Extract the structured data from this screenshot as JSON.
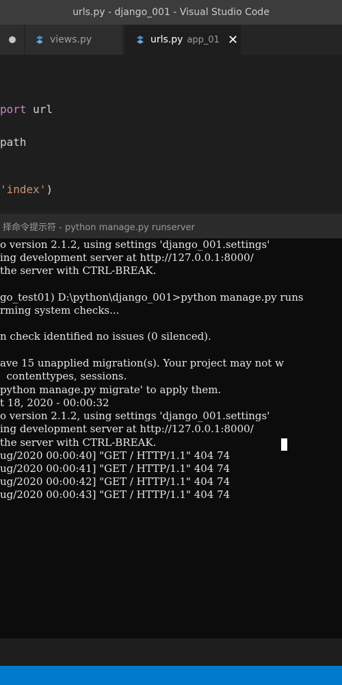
{
  "window": {
    "title": "urls.py - django_001 - Visual Studio Code"
  },
  "tabs": [
    {
      "label": "",
      "modified": true
    },
    {
      "label": "views.py",
      "icon": "python-file-icon"
    },
    {
      "label": "urls.py",
      "description": "app_01",
      "active": true,
      "icon": "python-file-icon"
    }
  ],
  "editor": {
    "lines": [
      {
        "kw": "port",
        "rest": " url"
      },
      {
        "kw": "",
        "rest": "path"
      },
      {
        "str": "'index'",
        "rest": ")"
      }
    ]
  },
  "cmd": {
    "title": "择命令提示符 - python  manage.py runserver",
    "lines": [
      "o version 2.1.2, using settings 'django_001.settings'",
      "ing development server at http://127.0.0.1:8000/",
      "the server with CTRL-BREAK.",
      "",
      "go_test01) D:\\python\\django_001>python manage.py runs",
      "rming system checks...",
      "",
      "n check identified no issues (0 silenced).",
      "",
      "ave 15 unapplied migration(s). Your project may not w",
      "  contenttypes, sessions.",
      "python manage.py migrate' to apply them.",
      "t 18, 2020 - 00:00:32",
      "o version 2.1.2, using settings 'django_001.settings'",
      "ing development server at http://127.0.0.1:8000/",
      "the server with CTRL-BREAK.",
      "ug/2020 00:00:40] \"GET / HTTP/1.1\" 404 74",
      "ug/2020 00:00:41] \"GET / HTTP/1.1\" 404 74",
      "ug/2020 00:00:42] \"GET / HTTP/1.1\" 404 74",
      "ug/2020 00:00:43] \"GET / HTTP/1.1\" 404 74"
    ]
  },
  "colors": {
    "status_bar": "#007acc",
    "keyword": "#c586c0",
    "string": "#ce9178",
    "python_icon": "#4b8bbe"
  }
}
